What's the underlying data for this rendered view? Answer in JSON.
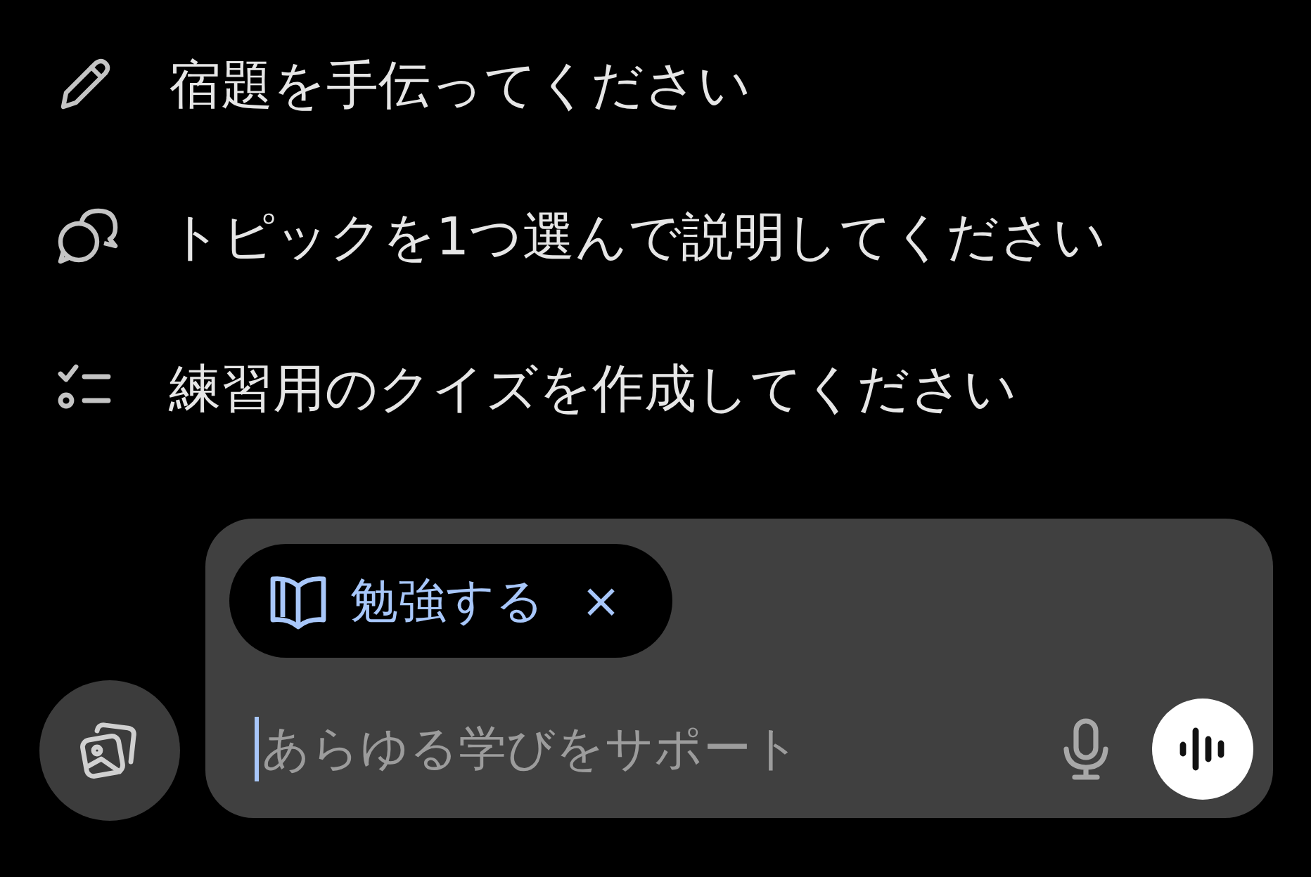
{
  "suggestions": [
    {
      "kind": "pencil",
      "label": "宿題を手伝ってください"
    },
    {
      "kind": "chat",
      "label": "トピックを1つ選んで説明してください"
    },
    {
      "kind": "checklist",
      "label": "練習用のクイズを作成してください"
    }
  ],
  "composer": {
    "chip": {
      "label": "勉強する",
      "close": "×"
    },
    "placeholder": "あらゆる学びをサポート"
  }
}
